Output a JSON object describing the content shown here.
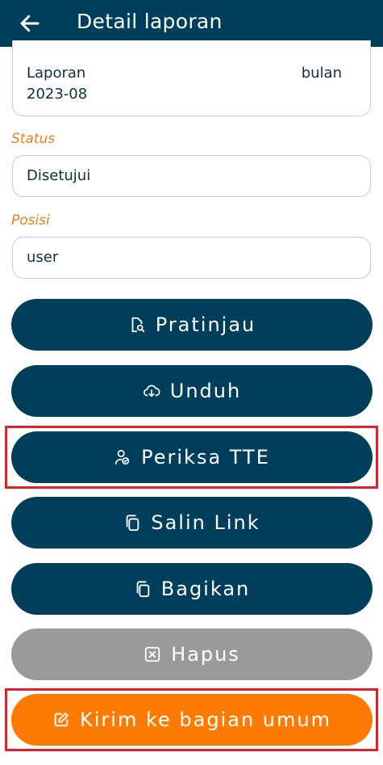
{
  "header": {
    "title": "Detail laporan",
    "back_icon": "arrow-left-icon"
  },
  "report": {
    "label_left": "Laporan",
    "label_right": "bulan",
    "period": "2023-08"
  },
  "status": {
    "label": "Status",
    "value": "Disetujui"
  },
  "position": {
    "label": "Posisi",
    "value": "user"
  },
  "buttons": {
    "preview": {
      "label": "Pratinjau",
      "icon": "file-search-icon"
    },
    "download": {
      "label": "Unduh",
      "icon": "cloud-download-icon"
    },
    "check_tte": {
      "label": "Periksa TTE",
      "icon": "user-check-icon"
    },
    "copy_link": {
      "label": "Salin Link",
      "icon": "copy-icon"
    },
    "share": {
      "label": "Bagikan",
      "icon": "copy-icon"
    },
    "delete": {
      "label": "Hapus",
      "icon": "close-box-icon"
    },
    "send": {
      "label": "Kirim ke bagian umum",
      "icon": "edit-icon"
    }
  },
  "colors": {
    "primary": "#003f5c",
    "accent_label": "#e8801c",
    "disabled": "#9a9a9a",
    "send": "#ff7a00",
    "highlight": "#e0202a"
  }
}
